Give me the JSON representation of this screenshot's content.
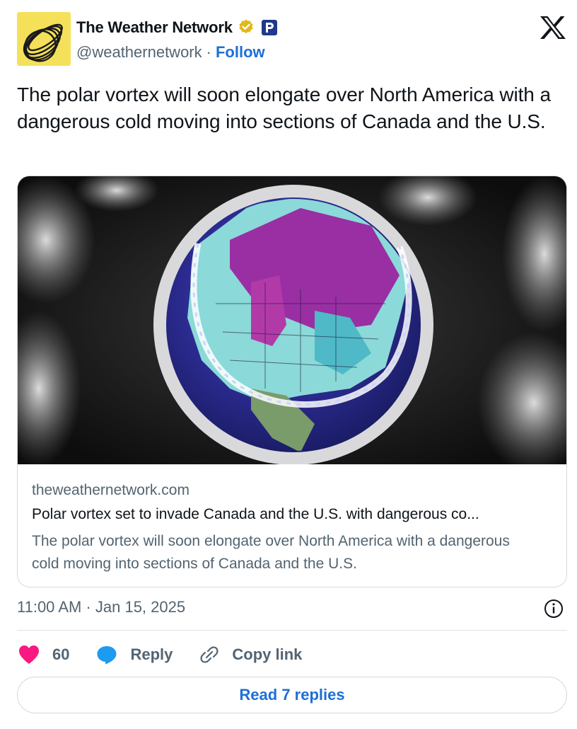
{
  "account": {
    "display_name": "The Weather Network",
    "handle": "@weathernetwork",
    "separator": "·",
    "follow_label": "Follow",
    "avatar_icon": "weather-network-logo",
    "verified_icon": "verified-gold-badge",
    "affiliation_icon": "affiliate-badge"
  },
  "tweet": {
    "text": "The polar vortex will soon elongate over North America with a dangerous cold moving into sections of Canada and the U.S."
  },
  "card": {
    "image_icon": "polar-vortex-globe-image",
    "domain": "theweathernetwork.com",
    "title": "Polar vortex set to invade Canada and the U.S. with dangerous co...",
    "description": "The polar vortex will soon elongate over North America with a dangerous cold moving into sections of Canada and the U.S."
  },
  "meta": {
    "timestamp": "11:00 AM · Jan 15, 2025"
  },
  "actions": {
    "like_count": "60",
    "reply_label": "Reply",
    "copy_link_label": "Copy link"
  },
  "replies": {
    "read_label": "Read 7 replies"
  },
  "colors": {
    "accent": "#1d6fd6",
    "like": "#f91880",
    "reply_icon": "#1d9bf0",
    "secondary_text": "#536471",
    "avatar_bg": "#f5e05a",
    "verified_gold": "#e2b719"
  }
}
